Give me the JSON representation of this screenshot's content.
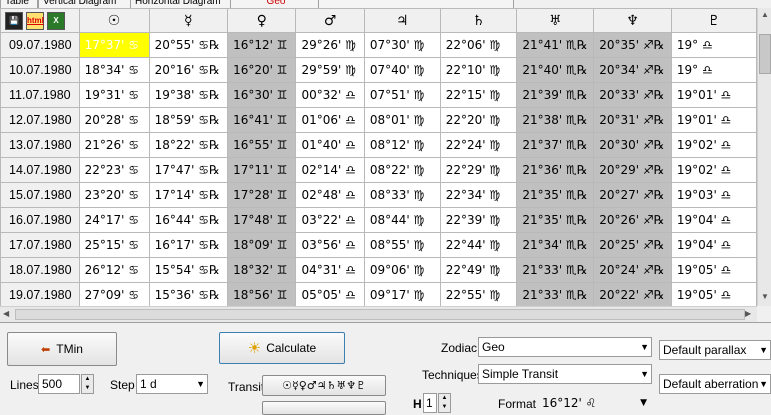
{
  "tabs": [
    "Table",
    "Vertical Diagram",
    "Horizontal Diagram",
    "Geo"
  ],
  "toolbar": {
    "save": "💾",
    "html": "html",
    "xls": "X"
  },
  "columns": [
    "☉",
    "☿",
    "♀",
    "♂",
    "♃",
    "♄",
    "♅",
    "♆",
    "♇"
  ],
  "gray_cols": [
    2,
    6,
    7
  ],
  "rows": [
    {
      "date": "09.07.1980",
      "cells": [
        "17°37' ♋",
        "20°55' ♋℞",
        "16°12' ♊",
        "29°26' ♍",
        "07°30' ♍",
        "22°06' ♍",
        "21°41' ♏℞",
        "20°35' ♐℞",
        "19° ♎"
      ]
    },
    {
      "date": "10.07.1980",
      "cells": [
        "18°34' ♋",
        "20°16' ♋℞",
        "16°20' ♊",
        "29°59' ♍",
        "07°40' ♍",
        "22°10' ♍",
        "21°40' ♏℞",
        "20°34' ♐℞",
        "19° ♎"
      ]
    },
    {
      "date": "11.07.1980",
      "cells": [
        "19°31' ♋",
        "19°38' ♋℞",
        "16°30' ♊",
        "00°32' ♎",
        "07°51' ♍",
        "22°15' ♍",
        "21°39' ♏℞",
        "20°33' ♐℞",
        "19°01' ♎"
      ]
    },
    {
      "date": "12.07.1980",
      "cells": [
        "20°28' ♋",
        "18°59' ♋℞",
        "16°41' ♊",
        "01°06' ♎",
        "08°01' ♍",
        "22°20' ♍",
        "21°38' ♏℞",
        "20°31' ♐℞",
        "19°01' ♎"
      ]
    },
    {
      "date": "13.07.1980",
      "cells": [
        "21°26' ♋",
        "18°22' ♋℞",
        "16°55' ♊",
        "01°40' ♎",
        "08°12' ♍",
        "22°24' ♍",
        "21°37' ♏℞",
        "20°30' ♐℞",
        "19°02' ♎"
      ]
    },
    {
      "date": "14.07.1980",
      "cells": [
        "22°23' ♋",
        "17°47' ♋℞",
        "17°11' ♊",
        "02°14' ♎",
        "08°22' ♍",
        "22°29' ♍",
        "21°36' ♏℞",
        "20°29' ♐℞",
        "19°02' ♎"
      ]
    },
    {
      "date": "15.07.1980",
      "cells": [
        "23°20' ♋",
        "17°14' ♋℞",
        "17°28' ♊",
        "02°48' ♎",
        "08°33' ♍",
        "22°34' ♍",
        "21°35' ♏℞",
        "20°27' ♐℞",
        "19°03' ♎"
      ]
    },
    {
      "date": "16.07.1980",
      "cells": [
        "24°17' ♋",
        "16°44' ♋℞",
        "17°48' ♊",
        "03°22' ♎",
        "08°44' ♍",
        "22°39' ♍",
        "21°35' ♏℞",
        "20°26' ♐℞",
        "19°04' ♎"
      ]
    },
    {
      "date": "17.07.1980",
      "cells": [
        "25°15' ♋",
        "16°17' ♋℞",
        "18°09' ♊",
        "03°56' ♎",
        "08°55' ♍",
        "22°44' ♍",
        "21°34' ♏℞",
        "20°25' ♐℞",
        "19°04' ♎"
      ]
    },
    {
      "date": "18.07.1980",
      "cells": [
        "26°12' ♋",
        "15°54' ♋℞",
        "18°32' ♊",
        "04°31' ♎",
        "09°06' ♍",
        "22°49' ♍",
        "21°33' ♏℞",
        "20°24' ♐℞",
        "19°05' ♎"
      ]
    },
    {
      "date": "19.07.1980",
      "cells": [
        "27°09' ♋",
        "15°36' ♋℞",
        "18°56' ♊",
        "05°05' ♎",
        "09°17' ♍",
        "22°55' ♍",
        "21°33' ♏℞",
        "20°22' ♐℞",
        "19°05' ♎"
      ]
    }
  ],
  "controls": {
    "tmin_label": "TMin",
    "calculate_label": "Calculate",
    "lines_label": "Lines",
    "lines_value": "500",
    "step_label": "Step",
    "step_value": "1 d",
    "transit_label": "Transit",
    "transit_value": "☉☿♀♂♃♄♅♆♇",
    "zodiac_label": "Zodiac",
    "zodiac_value": "Geo",
    "techniques_label": "Techniques",
    "techniques_value": "Simple Transit",
    "parallax_value": "Default parallax",
    "aberration_value": "Default aberration",
    "h_label": "H",
    "h_value": "1",
    "format_label": "Format",
    "format_value": "16°12' ♌"
  },
  "colors": {
    "highlight": "#ffff00",
    "gray_column": "#c0c0c0",
    "tab_red": "#d00000"
  }
}
